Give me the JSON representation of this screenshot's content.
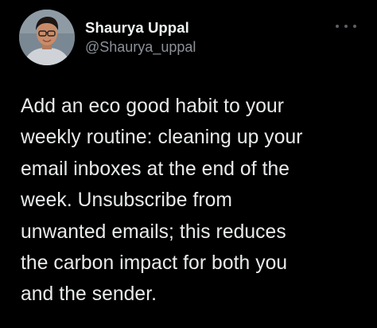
{
  "tweet": {
    "author": {
      "display_name": "Shaurya Uppal",
      "handle": "@Shaurya_uppal",
      "avatar_icon": "profile-photo"
    },
    "more_icon": "more-options-icon",
    "text_lines": [
      "Add an eco good habit to your",
      "weekly routine: cleaning up your",
      "email inboxes at the end of the",
      "week. Unsubscribe from",
      "unwanted emails; this reduces",
      "the carbon impact for both you",
      "and the sender."
    ]
  },
  "theme": {
    "background": "#000000",
    "text": "#e9ebec",
    "secondary_text": "#8b9197"
  }
}
